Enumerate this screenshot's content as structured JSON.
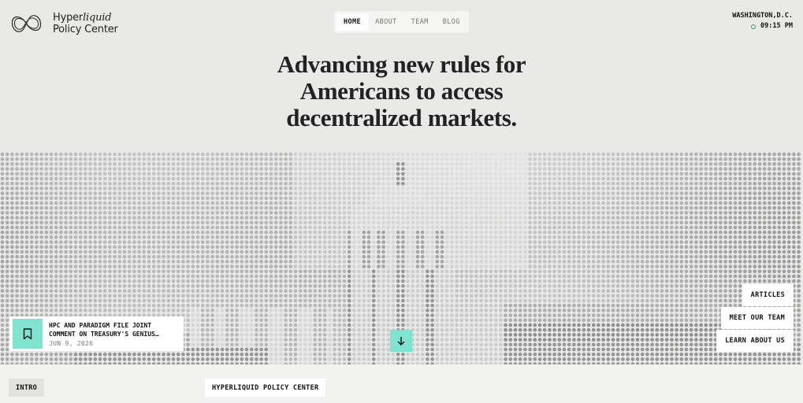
{
  "brand": {
    "name_line1_prefix": "Hyper",
    "name_line1_italic": "liquid",
    "name_line2": "Policy Center",
    "logo_icon": "infinity-loop-icon"
  },
  "nav": {
    "items": [
      {
        "label": "HOME",
        "active": true
      },
      {
        "label": "ABOUT",
        "active": false
      },
      {
        "label": "TEAM",
        "active": false
      },
      {
        "label": "BLOG",
        "active": false
      }
    ]
  },
  "location": {
    "city": "WASHINGTON,D.C.",
    "time": "09:15 PM"
  },
  "hero": {
    "headline_line1": "Advancing new rules for",
    "headline_line2": "Americans to access",
    "headline_line3": "decentralized markets.",
    "image": "capitol-building-dot-matrix"
  },
  "news": {
    "title_line1": "HPC AND PARADIGM FILE JOINT",
    "title_line2": "COMMENT ON TREASURY'S GENIUS…",
    "date": "JUN 9, 2026",
    "icon": "bookmark-icon"
  },
  "actions": {
    "articles": "ARTICLES",
    "meet_team": "MEET OUR TEAM",
    "learn_about": "LEARN ABOUT US",
    "scroll_icon": "arrow-down-icon"
  },
  "footer_tags": {
    "intro": "INTRO",
    "hpc": "HYPERLIQUID POLICY CENTER"
  },
  "colors": {
    "accent": "#7fe3cf",
    "clock": "#2c9a72",
    "background": "#e9e9e7"
  }
}
